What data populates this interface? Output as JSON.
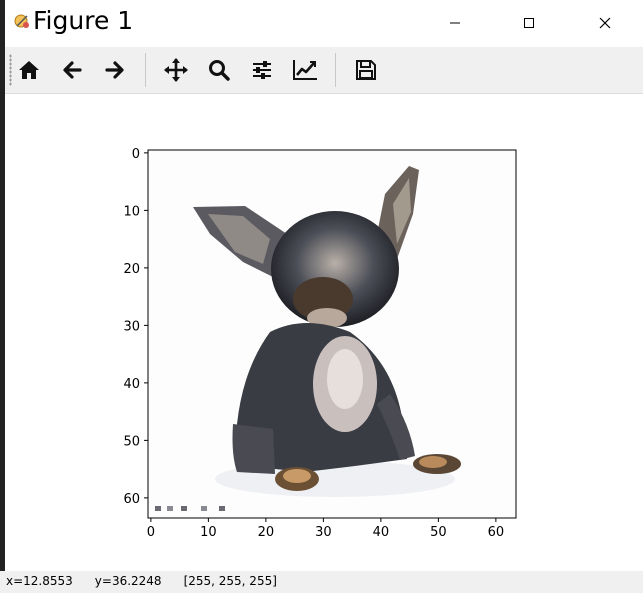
{
  "window": {
    "title": "Figure 1",
    "controls": [
      "minimize",
      "maximize",
      "close"
    ]
  },
  "toolbar": {
    "buttons": [
      {
        "icon": "home-icon"
      },
      {
        "icon": "back-arrow-icon"
      },
      {
        "icon": "forward-arrow-icon"
      },
      {
        "icon": "pan-icon"
      },
      {
        "icon": "zoom-icon"
      },
      {
        "icon": "configure-subplots-icon"
      },
      {
        "icon": "edit-axis-icon"
      },
      {
        "icon": "save-icon"
      }
    ]
  },
  "plot": {
    "x_ticks": [
      "0",
      "10",
      "20",
      "30",
      "40",
      "50",
      "60"
    ],
    "y_ticks": [
      "0",
      "10",
      "20",
      "30",
      "40",
      "50",
      "60"
    ],
    "image_size": [
      64,
      64
    ]
  },
  "status": {
    "x": "x=12.8553",
    "y": "y=36.2248",
    "pixel": "[255, 255, 255]"
  }
}
